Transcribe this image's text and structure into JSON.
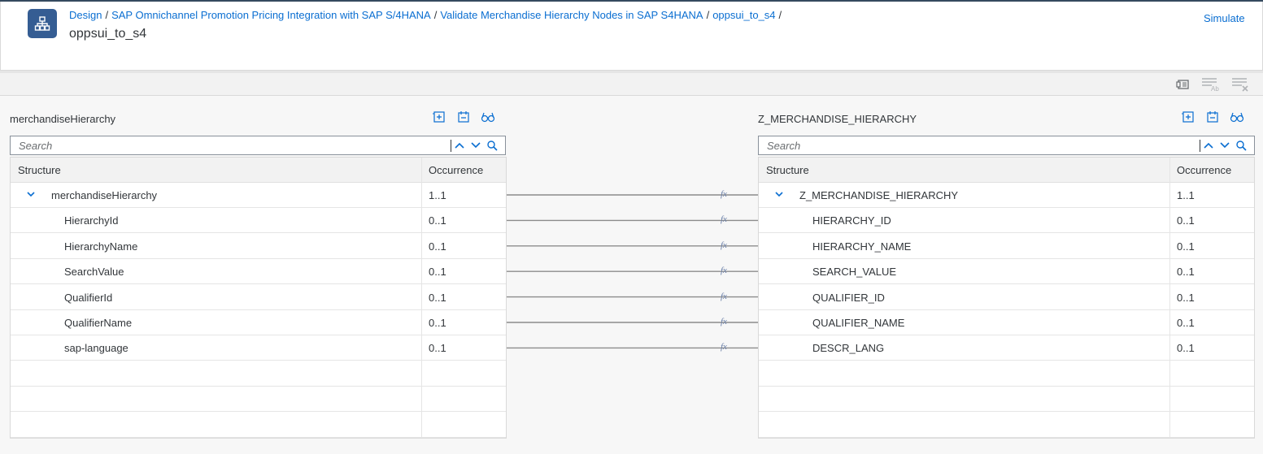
{
  "header": {
    "breadcrumb": [
      "Design",
      "SAP Omnichannel Promotion Pricing Integration with SAP S/4HANA",
      "Validate Merchandise Hierarchy Nodes in SAP S4HANA",
      "oppsui_to_s4"
    ],
    "separator": "/",
    "title": "oppsui_to_s4",
    "simulate_label": "Simulate"
  },
  "toolbar": {
    "icons": [
      "data-type-icon",
      "filter-text-icon",
      "clear-filter-icon"
    ]
  },
  "source": {
    "label": "merchandiseHierarchy",
    "search_placeholder": "Search",
    "col_structure": "Structure",
    "col_occurrence": "Occurrence",
    "rows": [
      {
        "name": "merchandiseHierarchy",
        "occ": "1..1"
      },
      {
        "name": "HierarchyId",
        "occ": "0..1"
      },
      {
        "name": "HierarchyName",
        "occ": "0..1"
      },
      {
        "name": "SearchValue",
        "occ": "0..1"
      },
      {
        "name": "QualifierId",
        "occ": "0..1"
      },
      {
        "name": "QualifierName",
        "occ": "0..1"
      },
      {
        "name": "sap-language",
        "occ": "0..1"
      }
    ]
  },
  "target": {
    "label": "Z_MERCHANDISE_HIERARCHY",
    "search_placeholder": "Search",
    "col_structure": "Structure",
    "col_occurrence": "Occurrence",
    "rows": [
      {
        "name": "Z_MERCHANDISE_HIERARCHY",
        "occ": "1..1"
      },
      {
        "name": "HIERARCHY_ID",
        "occ": "0..1"
      },
      {
        "name": "HIERARCHY_NAME",
        "occ": "0..1"
      },
      {
        "name": "SEARCH_VALUE",
        "occ": "0..1"
      },
      {
        "name": "QUALIFIER_ID",
        "occ": "0..1"
      },
      {
        "name": "QUALIFIER_NAME",
        "occ": "0..1"
      },
      {
        "name": "DESCR_LANG",
        "occ": "0..1"
      }
    ]
  },
  "mapping": {
    "fx_label": "fx"
  },
  "colors": {
    "link": "#0a6ed1",
    "app_icon": "#355d93",
    "mapping_line": "#8c8c8c"
  }
}
